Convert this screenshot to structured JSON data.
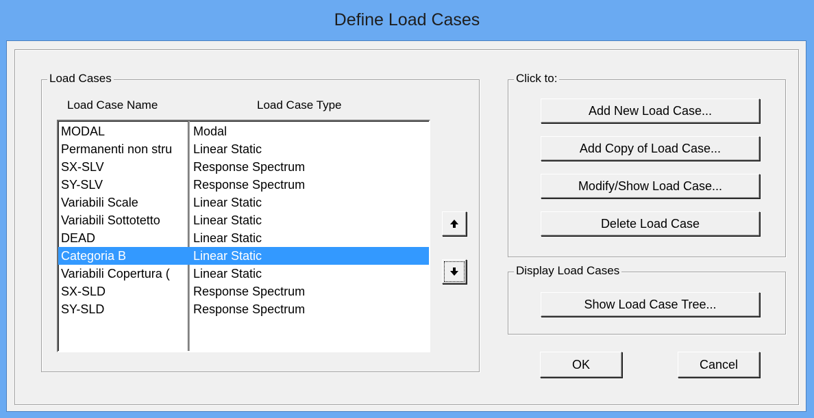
{
  "window": {
    "title": "Define Load Cases"
  },
  "load_cases": {
    "group_label": "Load Cases",
    "columns": {
      "name": "Load Case Name",
      "type": "Load Case Type"
    },
    "rows": [
      {
        "name": "MODAL",
        "type": "Modal"
      },
      {
        "name": "Permanenti non stru",
        "type": "Linear Static"
      },
      {
        "name": "SX-SLV",
        "type": "Response Spectrum"
      },
      {
        "name": "SY-SLV",
        "type": "Response Spectrum"
      },
      {
        "name": "Variabili Scale",
        "type": "Linear Static"
      },
      {
        "name": "Variabili Sottotetto",
        "type": "Linear Static"
      },
      {
        "name": "DEAD",
        "type": "Linear Static"
      },
      {
        "name": "Categoria B",
        "type": "Linear Static"
      },
      {
        "name": "Variabili Copertura (",
        "type": "Linear Static"
      },
      {
        "name": "SX-SLD",
        "type": "Response Spectrum"
      },
      {
        "name": "SY-SLD",
        "type": "Response Spectrum"
      }
    ],
    "selected_index": 7,
    "move_up_icon": "arrow-up-icon",
    "move_down_icon": "arrow-down-icon"
  },
  "click_to": {
    "group_label": "Click to:",
    "add_new": "Add New Load Case...",
    "add_copy": "Add Copy of Load Case...",
    "modify_show": "Modify/Show Load Case...",
    "delete": "Delete Load Case"
  },
  "display": {
    "group_label": "Display Load Cases",
    "show_tree": "Show Load Case Tree..."
  },
  "footer": {
    "ok": "OK",
    "cancel": "Cancel"
  },
  "colors": {
    "titlebar": "#6aaaf2",
    "dialog_bg": "#f0f0f0",
    "selection": "#3399ff"
  }
}
